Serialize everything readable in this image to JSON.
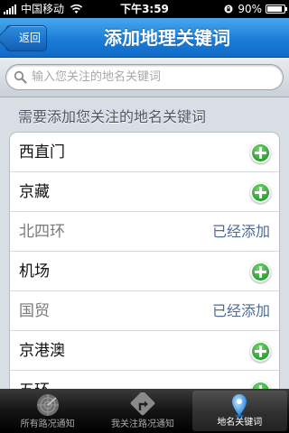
{
  "status_bar": {
    "carrier": "中国移动",
    "time": "下午3:59",
    "battery": "90%",
    "battery_level": 0.9
  },
  "nav": {
    "back_label": "返回",
    "title": "添加地理关键词"
  },
  "search": {
    "placeholder": "输入您关注的地名关键词",
    "value": ""
  },
  "section": {
    "header": "需要添加您关注的地名关键词"
  },
  "places": [
    {
      "name": "西直门",
      "added": false,
      "status": ""
    },
    {
      "name": "京藏",
      "added": false,
      "status": ""
    },
    {
      "name": "北四环",
      "added": true,
      "status": "已经添加"
    },
    {
      "name": "机场",
      "added": false,
      "status": ""
    },
    {
      "name": "国贸",
      "added": true,
      "status": "已经添加"
    },
    {
      "name": "京港澳",
      "added": false,
      "status": ""
    },
    {
      "name": "五环",
      "added": false,
      "status": ""
    }
  ],
  "tab_bar": {
    "tabs": [
      {
        "label": "所有路况通知",
        "icon": "radar-icon",
        "active": false
      },
      {
        "label": "我关注路况通知",
        "icon": "turn-arrow-icon",
        "active": false
      },
      {
        "label": "地名关键词",
        "icon": "location-pin-icon",
        "active": true
      }
    ]
  },
  "colors": {
    "nav_blue": "#1b7dd8",
    "add_green": "#1e9a26",
    "added_text": "#4f6a93"
  }
}
